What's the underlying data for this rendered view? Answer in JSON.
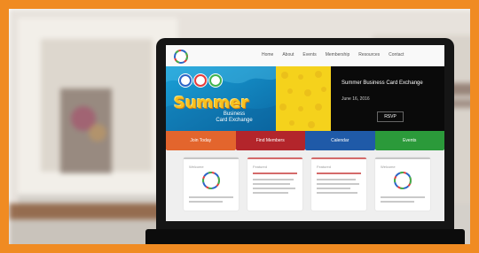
{
  "photo": {
    "frame_color": "#f08b22",
    "scene_colors": {
      "wall": "#e7e2dc",
      "wood": "#8a5b3a",
      "shelf": "#6d5144",
      "table": "#d4d0ca",
      "laptop": "#151515"
    }
  },
  "website": {
    "header_nav": [
      "Home",
      "About",
      "Events",
      "Membership",
      "Resources",
      "Contact"
    ],
    "hero": {
      "summer_text": "Summer",
      "subtitle": "Business\nCard Exchange",
      "right_title": "Summer Business Card Exchange",
      "right_date": "June 16, 2016",
      "right_button": "RSVP"
    },
    "tabs": [
      {
        "label": "Join Today",
        "color": "#e3652d"
      },
      {
        "label": "Find Members",
        "color": "#b3252b"
      },
      {
        "label": "Calendar",
        "color": "#1f5aa8"
      },
      {
        "label": "Events",
        "color": "#2b9a3a"
      }
    ],
    "cards": [
      {
        "label": "Welcome",
        "accent": "#c7c7c7"
      },
      {
        "label": "Featured",
        "accent": "#d46b6b"
      },
      {
        "label": "Featured",
        "accent": "#d46b6b"
      },
      {
        "label": "Welcome",
        "accent": "#c7c7c7"
      }
    ]
  }
}
